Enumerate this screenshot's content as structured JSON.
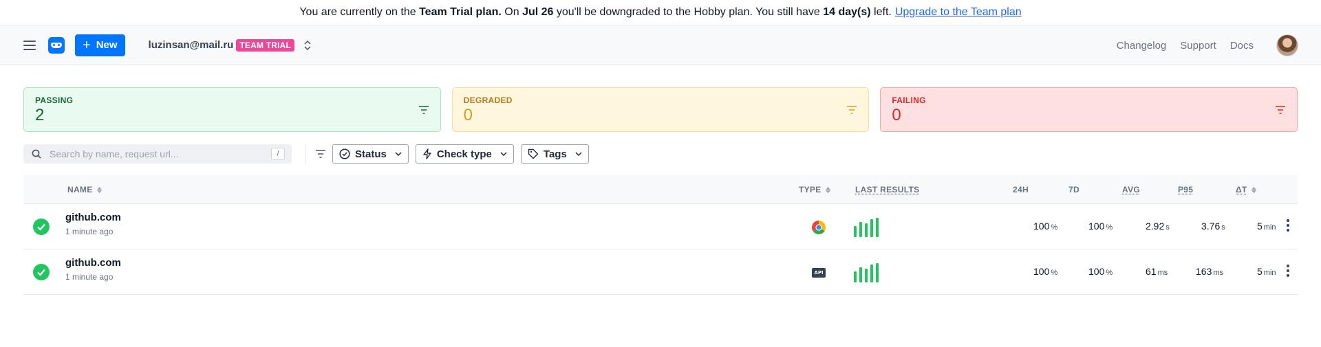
{
  "banner": {
    "part1": "You are currently on the ",
    "plan": "Team Trial plan.",
    "part2": " On ",
    "date": "Jul 26",
    "part3": " you'll be downgraded to the Hobby plan. You still have ",
    "days": "14 day(s)",
    "part4": " left.",
    "link": "Upgrade to the Team plan"
  },
  "topbar": {
    "new_label": "New",
    "account": "luzinsan@mail.ru",
    "badge": "TEAM TRIAL",
    "links": [
      "Changelog",
      "Support",
      "Docs"
    ]
  },
  "cards": {
    "passing": {
      "title": "PASSING",
      "value": "2"
    },
    "degraded": {
      "title": "DEGRADED",
      "value": "0"
    },
    "failing": {
      "title": "FAILING",
      "value": "0"
    }
  },
  "filters": {
    "search_placeholder": "Search by name, request url...",
    "shortcut": "/",
    "status": "Status",
    "check_type": "Check type",
    "tags": "Tags"
  },
  "table": {
    "headers": {
      "name": "NAME",
      "type": "TYPE",
      "last_results": "LAST RESULTS",
      "h24": "24H",
      "d7": "7D",
      "avg": "AVG",
      "p95": "P95",
      "dt": "ΔT"
    },
    "rows": [
      {
        "name": "github.com",
        "time": "1 minute ago",
        "type_icon": "chrome-icon",
        "h24": "100",
        "h24_unit": "%",
        "d7": "100",
        "d7_unit": "%",
        "avg": "2.92",
        "avg_unit": "s",
        "p95": "3.76",
        "p95_unit": "s",
        "dt": "5",
        "dt_unit": "min"
      },
      {
        "name": "github.com",
        "time": "1 minute ago",
        "type_icon": "api-icon",
        "type_text": "API",
        "h24": "100",
        "h24_unit": "%",
        "d7": "100",
        "d7_unit": "%",
        "avg": "61",
        "avg_unit": "ms",
        "p95": "163",
        "p95_unit": "ms",
        "dt": "5",
        "dt_unit": "min"
      }
    ]
  },
  "colors": {
    "primary": "#0075ff",
    "passing": "#22c55e",
    "degraded": "#d4a017",
    "failing": "#dc2626",
    "badge": "#ec4899"
  }
}
